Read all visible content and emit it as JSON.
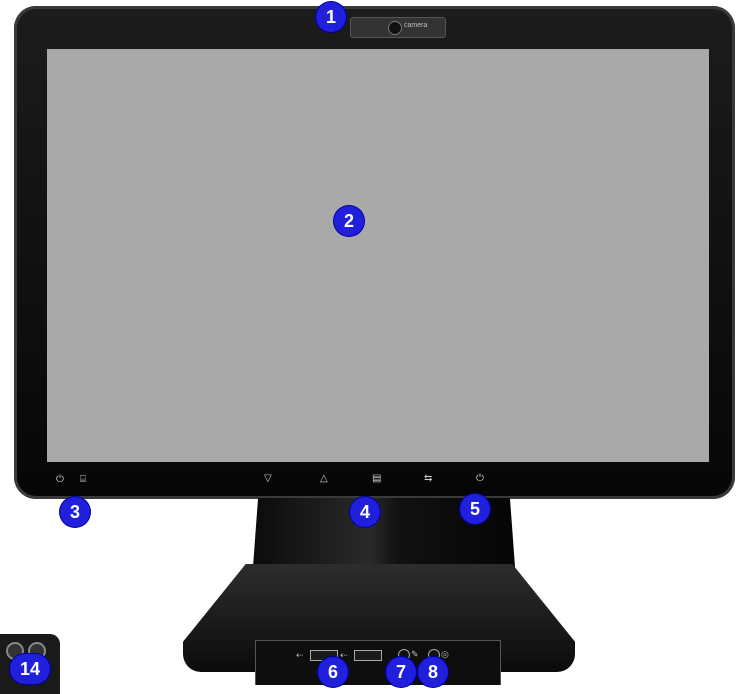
{
  "webcam": {
    "brand_text": "camera"
  },
  "front_controls": {
    "left_icons": [
      "⏻",
      "⌸"
    ],
    "buttons": [
      "▽",
      "△",
      "▤",
      "⇆",
      "⏻"
    ]
  },
  "ports": {
    "usb_symbol": "⇠",
    "mic_symbol": "✎",
    "headphone_symbol": "◎"
  },
  "callouts": [
    "1",
    "2",
    "3",
    "4",
    "5",
    "6",
    "7",
    "8"
  ],
  "inset_callout": "14",
  "colors": {
    "callout_fill": "#1f1fdc",
    "screen": "#a9a9a9",
    "bezel": "#0b0b0b"
  }
}
